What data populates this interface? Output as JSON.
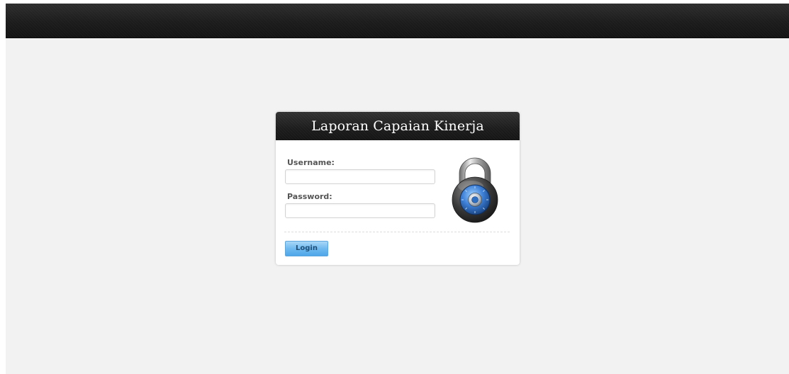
{
  "login": {
    "title": "Laporan Capaian Kinerja",
    "username_label": "Username:",
    "username_value": "",
    "password_label": "Password:",
    "password_value": "",
    "button_label": "Login",
    "icon": "padlock-icon"
  },
  "colors": {
    "page_background": "#f2f2f2",
    "top_bar": "#1f1f1f",
    "header_background": "#1c1c1c",
    "button_blue": "#6fbaf0",
    "lock_blue": "#3d7fd6"
  }
}
